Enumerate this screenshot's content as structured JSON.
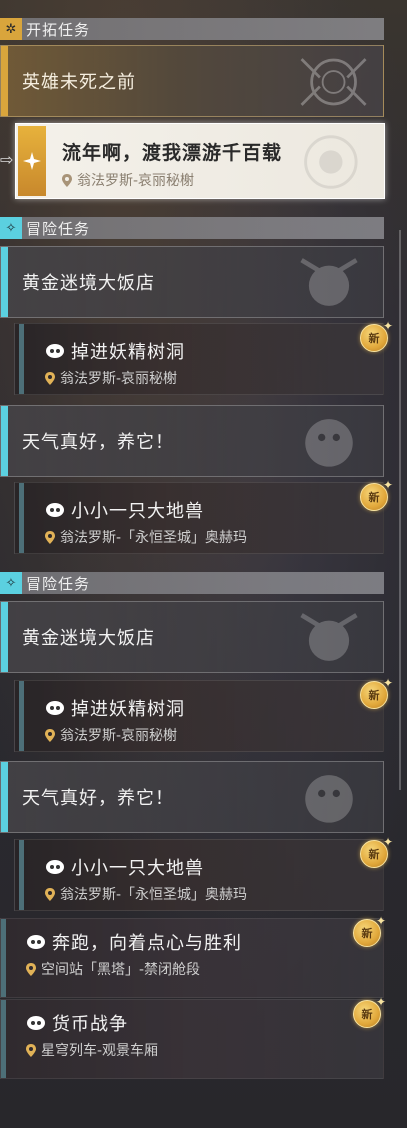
{
  "trailblaze": {
    "header": "开拓任务",
    "chapter": "英雄未死之前",
    "selected": {
      "title": "流年啊，渡我漂游千百载",
      "location": "翁法罗斯-哀丽秘榭"
    }
  },
  "adventure1": {
    "header": "冒险任务",
    "group1": {
      "title": "黄金迷境大饭店",
      "sub": {
        "title": "掉进妖精树洞",
        "location": "翁法罗斯-哀丽秘榭",
        "badge": "新"
      }
    },
    "group2": {
      "title": "天气真好，养它！",
      "sub": {
        "title": "小小一只大地兽",
        "location": "翁法罗斯-「永恒圣城」奥赫玛",
        "badge": "新"
      }
    }
  },
  "adventure2": {
    "header": "冒险任务",
    "group1": {
      "title": "黄金迷境大饭店",
      "sub": {
        "title": "掉进妖精树洞",
        "location": "翁法罗斯-哀丽秘榭",
        "badge": "新"
      }
    },
    "group2": {
      "title": "天气真好，养它！",
      "sub": {
        "title": "小小一只大地兽",
        "location": "翁法罗斯-「永恒圣城」奥赫玛",
        "badge": "新"
      }
    },
    "free1": {
      "title": "奔跑，向着点心与胜利",
      "location": "空间站「黑塔」-禁闭舱段",
      "badge": "新"
    },
    "free2": {
      "title": "货币战争",
      "location": "星穹列车-观景车厢",
      "badge": "新"
    }
  },
  "colors": {
    "trailblaze_accent": "#d9a53c",
    "adventure_accent": "#5bd0e0",
    "sub_bar": "#4d6f78",
    "new_badge": "#e1a83b"
  }
}
